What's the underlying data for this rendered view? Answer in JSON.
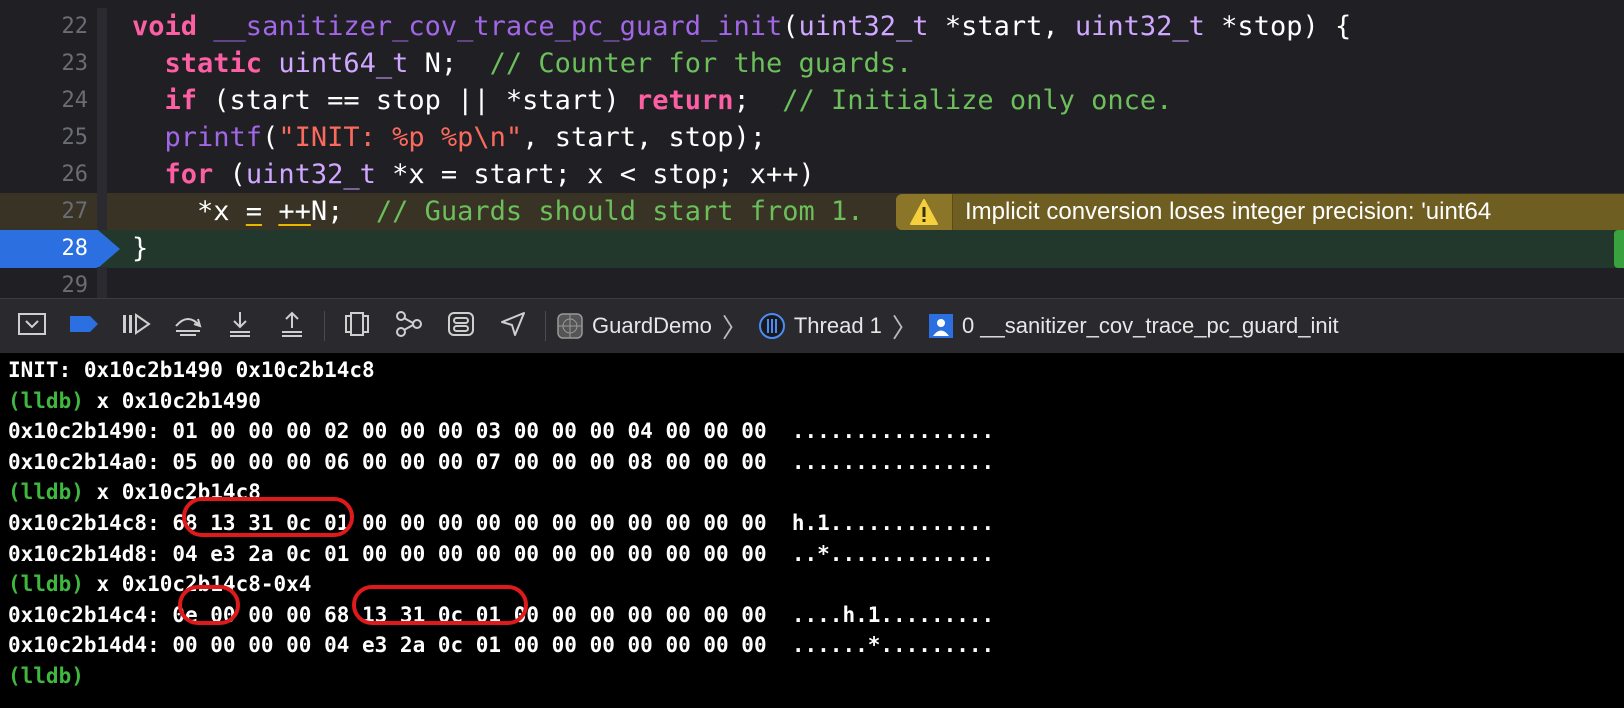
{
  "editor": {
    "lines": [
      {
        "num": "22",
        "tokens": [
          {
            "t": "void",
            "c": "kw"
          },
          {
            "t": " ",
            "c": "pl"
          },
          {
            "t": "__sanitizer_cov_trace_pc_guard_init",
            "c": "fn"
          },
          {
            "t": "(",
            "c": "pl"
          },
          {
            "t": "uint32_t",
            "c": "ty"
          },
          {
            "t": " *start, ",
            "c": "pl"
          },
          {
            "t": "uint32_t",
            "c": "ty"
          },
          {
            "t": " *stop) {",
            "c": "pl"
          }
        ]
      },
      {
        "num": "23",
        "tokens": [
          {
            "t": "  ",
            "c": "pl"
          },
          {
            "t": "static",
            "c": "kw"
          },
          {
            "t": " ",
            "c": "pl"
          },
          {
            "t": "uint64_t",
            "c": "ty"
          },
          {
            "t": " N;  ",
            "c": "pl"
          },
          {
            "t": "// Counter for the guards.",
            "c": "cm"
          }
        ]
      },
      {
        "num": "24",
        "tokens": [
          {
            "t": "  ",
            "c": "pl"
          },
          {
            "t": "if",
            "c": "kw"
          },
          {
            "t": " (start == stop || *start) ",
            "c": "pl"
          },
          {
            "t": "return",
            "c": "kw"
          },
          {
            "t": ";  ",
            "c": "pl"
          },
          {
            "t": "// Initialize only once.",
            "c": "cm"
          }
        ]
      },
      {
        "num": "25",
        "tokens": [
          {
            "t": "  ",
            "c": "pl"
          },
          {
            "t": "printf",
            "c": "fn"
          },
          {
            "t": "(",
            "c": "pl"
          },
          {
            "t": "\"INIT: ",
            "c": "str"
          },
          {
            "t": "%p %p",
            "c": "str"
          },
          {
            "t": "\\n\"",
            "c": "str"
          },
          {
            "t": ", start, stop);",
            "c": "pl"
          }
        ]
      },
      {
        "num": "26",
        "tokens": [
          {
            "t": "  ",
            "c": "pl"
          },
          {
            "t": "for",
            "c": "kw"
          },
          {
            "t": " (",
            "c": "pl"
          },
          {
            "t": "uint32_t",
            "c": "ty"
          },
          {
            "t": " *x = start; x < stop; x++)",
            "c": "pl"
          }
        ]
      },
      {
        "num": "27",
        "tokens": [
          {
            "t": "    *x ",
            "c": "pl"
          },
          {
            "t": "=",
            "c": "pl ul"
          },
          {
            "t": " ",
            "c": "pl"
          },
          {
            "t": "++",
            "c": "pl ul"
          },
          {
            "t": "N;  ",
            "c": "pl"
          },
          {
            "t": "// Guards should start from 1.",
            "c": "cm"
          }
        ]
      },
      {
        "num": "28",
        "tokens": [
          {
            "t": "}",
            "c": "pl"
          }
        ]
      },
      {
        "num": "29",
        "tokens": []
      }
    ],
    "warning": {
      "icon": "warning-triangle-icon",
      "text": "Implicit conversion loses integer precision: 'uint64"
    }
  },
  "debug_bar": {
    "buttons": [
      {
        "name": "hide-debug-area-button",
        "icon": "hide-debug-area-icon"
      },
      {
        "name": "breakpoints-toggle-button",
        "icon": "breakpoint-icon"
      },
      {
        "name": "continue-button",
        "icon": "continue-icon"
      },
      {
        "name": "step-over-button",
        "icon": "step-over-icon"
      },
      {
        "name": "step-into-button",
        "icon": "step-into-icon"
      },
      {
        "name": "step-out-button",
        "icon": "step-out-icon"
      },
      {
        "name": "view-debugger-button",
        "icon": "view-hierarchy-icon"
      },
      {
        "name": "memory-graph-button",
        "icon": "memory-graph-icon"
      },
      {
        "name": "environment-overrides-button",
        "icon": "environment-icon"
      },
      {
        "name": "simulate-location-button",
        "icon": "location-icon"
      }
    ],
    "breadcrumb": {
      "app": "GuardDemo",
      "thread": "Thread 1",
      "frame": "0 __sanitizer_cov_trace_pc_guard_init"
    },
    "accent": "#2b6fe0"
  },
  "console": {
    "lines": [
      {
        "prompt": "",
        "text": "INIT: 0x10c2b1490 0x10c2b14c8"
      },
      {
        "prompt": "(lldb)",
        "text": " x 0x10c2b1490"
      },
      {
        "prompt": "",
        "text": "0x10c2b1490: 01 00 00 00 02 00 00 00 03 00 00 00 04 00 00 00  ................"
      },
      {
        "prompt": "",
        "text": "0x10c2b14a0: 05 00 00 00 06 00 00 00 07 00 00 00 08 00 00 00  ................"
      },
      {
        "prompt": "(lldb)",
        "text": " x 0x10c2b14c8"
      },
      {
        "prompt": "",
        "text": "0x10c2b14c8: 68 13 31 0c 01 00 00 00 00 00 00 00 00 00 00 00  h.1............."
      },
      {
        "prompt": "",
        "text": "0x10c2b14d8: 04 e3 2a 0c 01 00 00 00 00 00 00 00 00 00 00 00  ..*............."
      },
      {
        "prompt": "(lldb)",
        "text": " x 0x10c2b14c8-0x4"
      },
      {
        "prompt": "",
        "text": "0x10c2b14c4: 0e 00 00 00 68 13 31 0c 01 00 00 00 00 00 00 00  ....h.1........."
      },
      {
        "prompt": "",
        "text": "0x10c2b14d4: 00 00 00 00 04 e3 2a 0c 01 00 00 00 00 00 00 00  ......*........."
      },
      {
        "prompt": "(lldb)",
        "text": ""
      }
    ],
    "highlight_color": "#e01a1a",
    "prompt_color": "#3fb83f"
  }
}
